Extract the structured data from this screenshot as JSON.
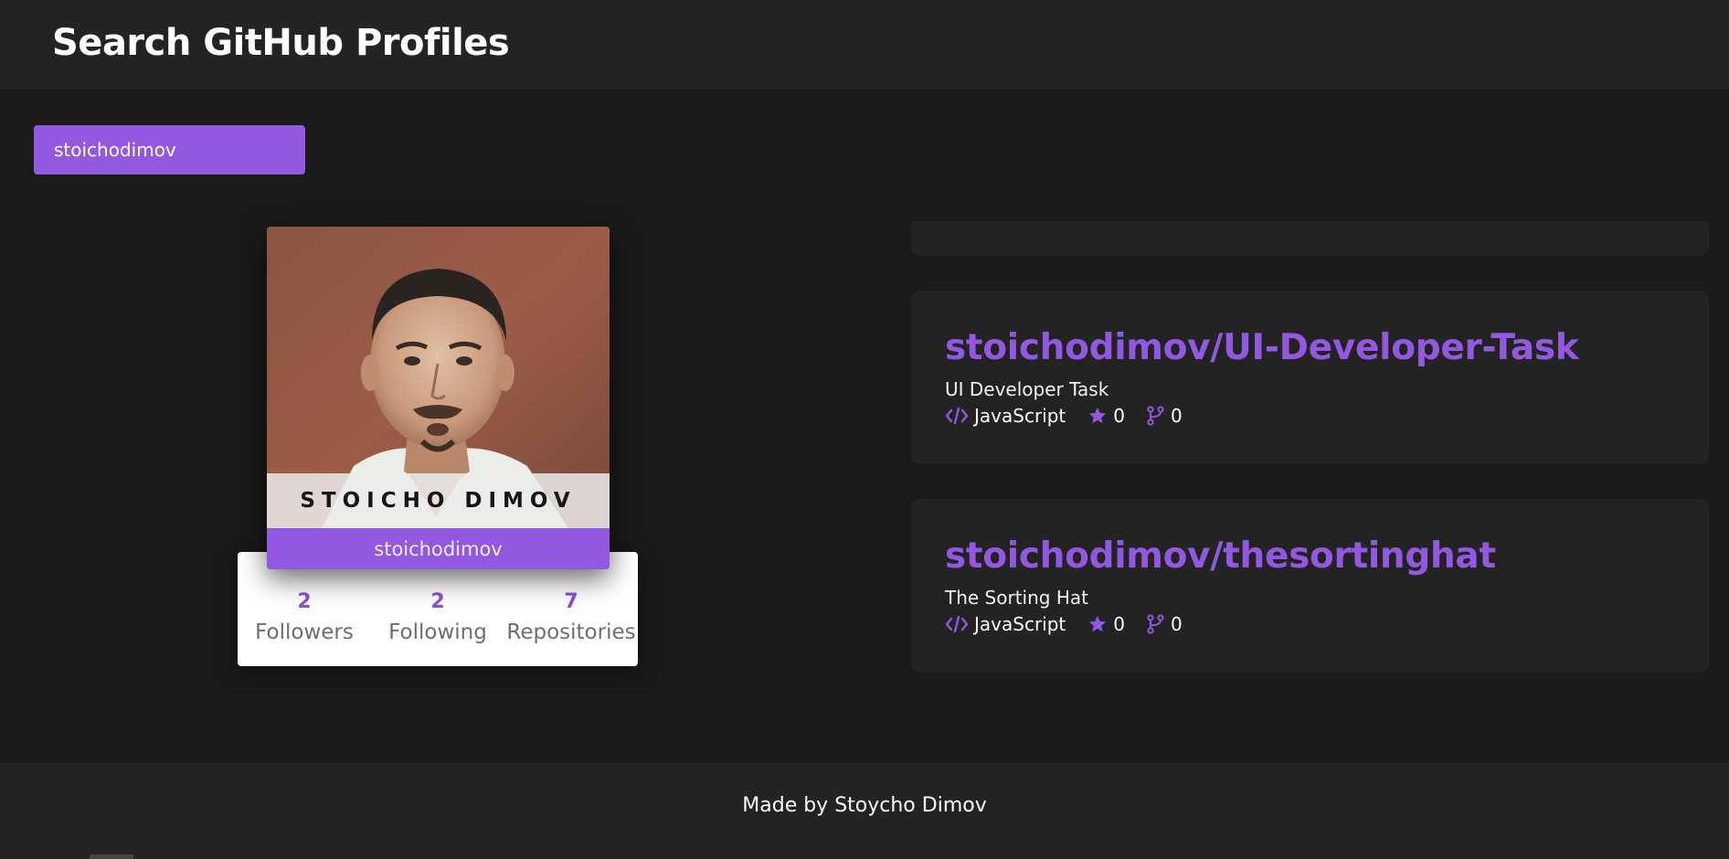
{
  "header": {
    "title": "Search GitHub Profiles"
  },
  "search": {
    "value": "stoichodimov"
  },
  "profile": {
    "name": "STOICHO DIMOV",
    "login": "stoichodimov",
    "stats": [
      {
        "value": "2",
        "label": "Followers"
      },
      {
        "value": "2",
        "label": "Following"
      },
      {
        "value": "7",
        "label": "Repositories"
      }
    ]
  },
  "repos": [
    {
      "name": "stoichodimov/UI-Developer-Task",
      "description": "UI Developer Task",
      "language": "JavaScript",
      "stars": "0",
      "forks": "0"
    },
    {
      "name": "stoichodimov/thesortinghat",
      "description": "The Sorting Hat",
      "language": "JavaScript",
      "stars": "0",
      "forks": "0"
    }
  ],
  "icons": {
    "code": "code-icon",
    "star": "star-icon",
    "fork": "fork-icon"
  },
  "colors": {
    "accent": "#9358e0",
    "background": "#1a1a1b",
    "panel": "#232324"
  },
  "footer": {
    "text": "Made by Stoycho Dimov"
  }
}
